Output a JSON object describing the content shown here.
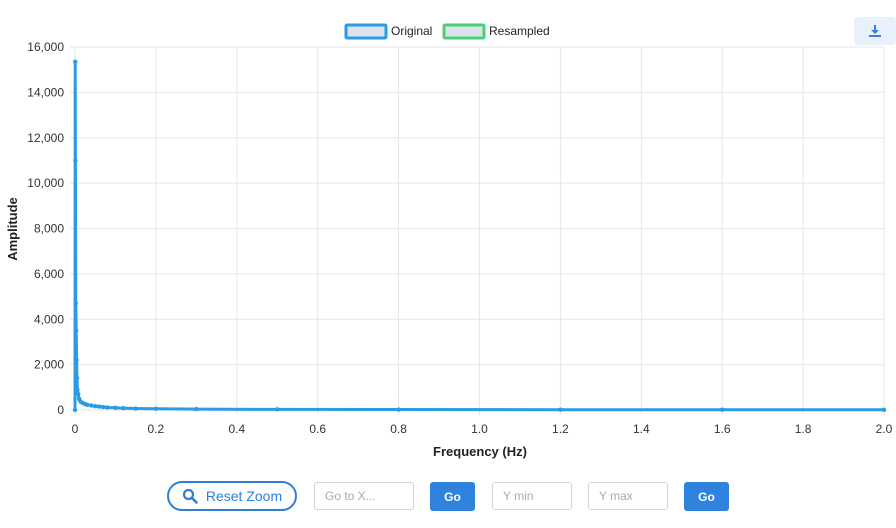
{
  "chart_data": {
    "type": "line",
    "xlabel": "Frequency (Hz)",
    "ylabel": "Amplitude",
    "xlim": [
      0,
      2
    ],
    "ylim": [
      0,
      16000
    ],
    "x_ticks": [
      0,
      0.2,
      0.4,
      0.6,
      0.8,
      1.0,
      1.2,
      1.4,
      1.6,
      1.8,
      2.0
    ],
    "x_tick_labels": [
      "0",
      "0.2",
      "0.4",
      "0.6",
      "0.8",
      "1.0",
      "1.2",
      "1.4",
      "1.6",
      "1.8",
      "2.0"
    ],
    "y_ticks": [
      0,
      2000,
      4000,
      6000,
      8000,
      10000,
      12000,
      14000,
      16000
    ],
    "y_tick_labels": [
      "0",
      "2,000",
      "4,000",
      "6,000",
      "8,000",
      "10,000",
      "12,000",
      "14,000",
      "16,000"
    ],
    "grid": true,
    "legend_position": "top-center",
    "series": [
      {
        "name": "Original",
        "color": "#2b9be6",
        "fill": "#dce3ea",
        "x": [
          0,
          0.0005,
          0.001,
          0.002,
          0.003,
          0.004,
          0.005,
          0.006,
          0.008,
          0.01,
          0.012,
          0.015,
          0.02,
          0.025,
          0.03,
          0.04,
          0.05,
          0.06,
          0.07,
          0.08,
          0.1,
          0.12,
          0.15,
          0.2,
          0.3,
          0.5,
          0.8,
          1.2,
          1.6,
          2.0
        ],
        "y": [
          0,
          15350,
          11000,
          4700,
          3500,
          2200,
          1400,
          900,
          700,
          500,
          420,
          350,
          300,
          260,
          230,
          200,
          170,
          150,
          130,
          110,
          95,
          80,
          65,
          55,
          40,
          28,
          20,
          15,
          12,
          10
        ]
      },
      {
        "name": "Resampled",
        "color": "#4ccf74",
        "fill": "#dce3ea",
        "x": [],
        "y": []
      }
    ]
  },
  "controls": {
    "reset_label": "Reset Zoom",
    "goto_x_placeholder": "Go to X...",
    "go_label": "Go",
    "ymin_placeholder": "Y min",
    "ymax_placeholder": "Y max",
    "go2_label": "Go"
  },
  "icons": {
    "download": "download-icon",
    "search": "search-icon"
  }
}
